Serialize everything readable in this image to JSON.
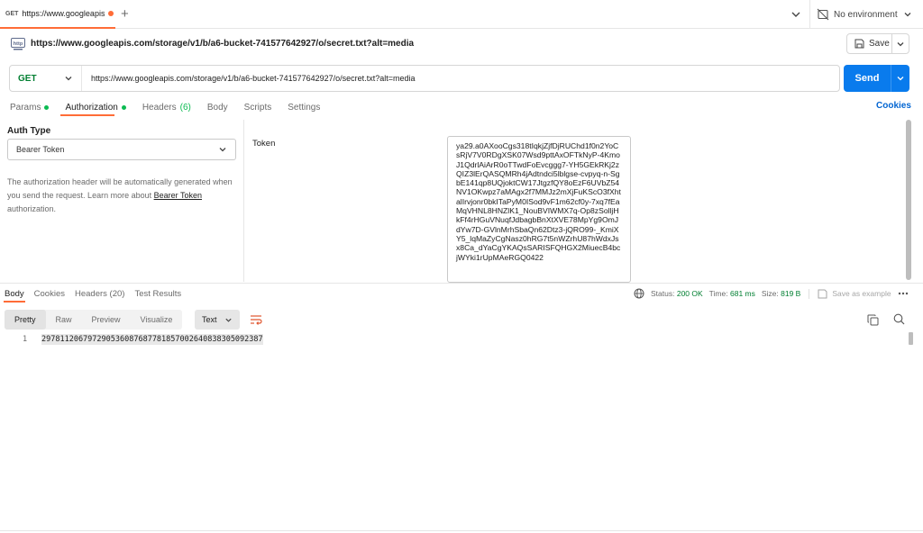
{
  "tab": {
    "method": "GET",
    "title": "https://www.googleapis",
    "new_tab_glyph": "+"
  },
  "environment": {
    "label": "No environment"
  },
  "request": {
    "title": "https://www.googleapis.com/storage/v1/b/a6-bucket-741577642927/o/secret.txt?alt=media",
    "save_label": "Save",
    "method": "GET",
    "url": "https://www.googleapis.com/storage/v1/b/a6-bucket-741577642927/o/secret.txt?alt=media",
    "send_label": "Send"
  },
  "request_tabs": {
    "params": "Params",
    "authorization": "Authorization",
    "headers": "Headers",
    "headers_count": "(6)",
    "body": "Body",
    "scripts": "Scripts",
    "settings": "Settings",
    "cookies": "Cookies"
  },
  "auth": {
    "type_label": "Auth Type",
    "type_value": "Bearer Token",
    "help_prefix": "The authorization header will be automatically generated when you send the request. Learn more about ",
    "help_link": "Bearer Token",
    "help_suffix": " authorization.",
    "token_label": "Token",
    "token_value": "ya29.a0AXooCgs318tIqkjZjfDjRUChd1f0n2YoCsRjV7V0RDgXSK07Wsd9pttAxOFTkNyP-4KmoJ1QdrlAiArR0oTTwdFoEvcggg7-YH5GEkRKj2zQIZ3lErQASQMRh4jAdtndci5lblgse-cvpyq-n-SgbE141qp8UQjoktCW17JtgzfQY8oEzF6UVbZ54NV1OKwpz7aMAgx2f7MMJz2mXjFuKScO3fXhtalIrvjonr0bkITaPyM0ISod9vF1m62cf0y-7xq7fEaMqVHNL8HNZlK1_NouBVIWMX7q-Op8zSolljHkFf4rHGuVNuqfJdbagbBnXtXVE78MpYg9OmJdYw7D-GVlnMrhSbaQn62Dtz3-jQRO99-_KmiXY5_lqMaZyCgNasz0hRG7t5nWZrhU87hWdxJsx8Ca_dYaCgYKAQsSARISFQHGX2MiuecB4bcjWYki1rUpMAeRGQ0422"
  },
  "response": {
    "tabs": [
      "Body",
      "Cookies",
      "Headers (20)",
      "Test Results"
    ],
    "status_label": "Status:",
    "status_value": "200 OK",
    "time_label": "Time:",
    "time_value": "681 ms",
    "size_label": "Size:",
    "size_value": "819 B",
    "save_example": "Save as example",
    "view_modes": [
      "Pretty",
      "Raw",
      "Preview",
      "Visualize"
    ],
    "format": "Text",
    "line_number": "1",
    "body_text": "2978112067972905360876877818570026408383050923​87"
  },
  "colors": {
    "accent": "#ff6c37",
    "send": "#097bed",
    "method_get": "#007f31",
    "link": "#0265d2"
  }
}
